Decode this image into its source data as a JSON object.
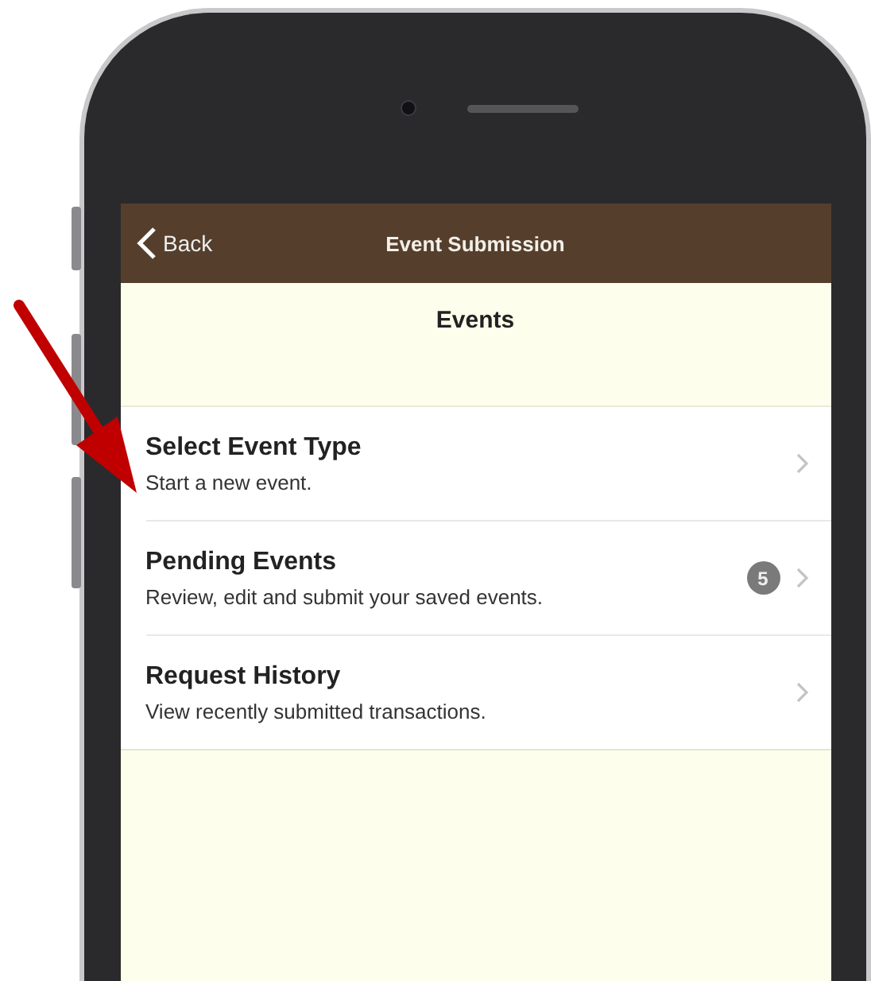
{
  "nav_bar": {
    "back_label": "Back",
    "title": "Event Submission"
  },
  "page_title": "Events",
  "items": [
    {
      "title": "Select Event Type",
      "subtitle": "Start a new event."
    },
    {
      "title": "Pending Events",
      "subtitle": "Review, edit and submit your saved events.",
      "badge": "5"
    },
    {
      "title": "Request History",
      "subtitle": "View recently submitted transactions."
    }
  ]
}
